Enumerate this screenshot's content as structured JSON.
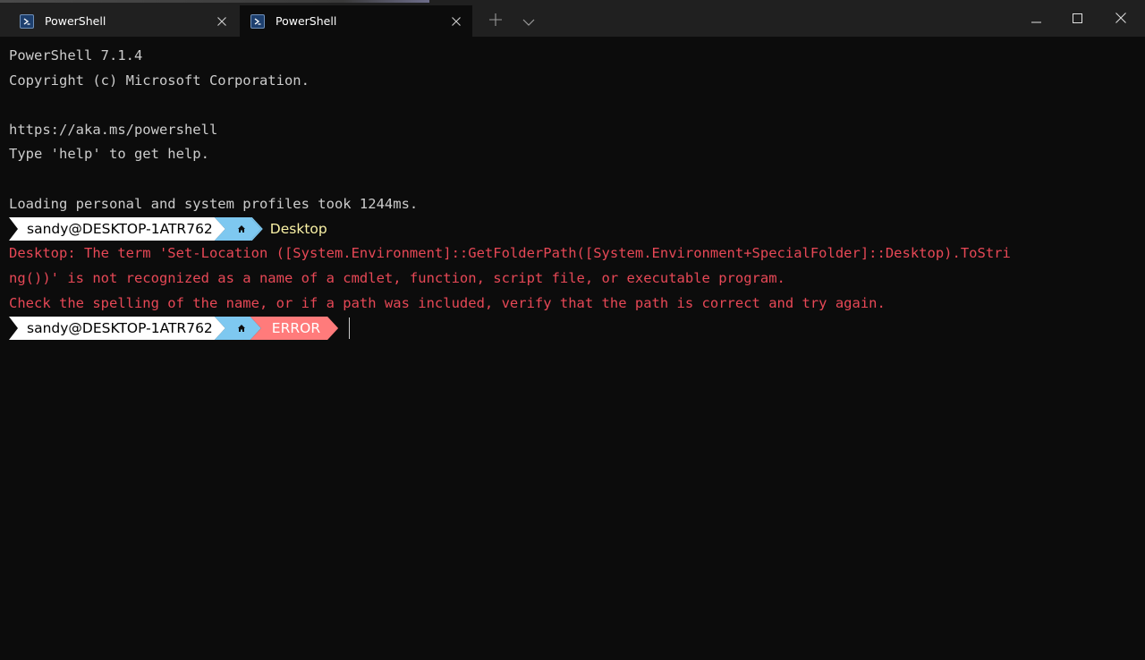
{
  "window": {
    "tabs": [
      {
        "label": "PowerShell",
        "active": false
      },
      {
        "label": "PowerShell",
        "active": true
      }
    ],
    "icons": {
      "tab": "powershell-icon",
      "close": "close-icon",
      "new_tab": "plus-icon",
      "dropdown": "chevron-down-icon",
      "minimize": "minimize-icon",
      "maximize": "maximize-icon",
      "window_close": "close-icon"
    }
  },
  "terminal": {
    "lines": [
      "PowerShell 7.1.4",
      "Copyright (c) Microsoft Corporation.",
      "",
      "https://aka.ms/powershell",
      "Type 'help' to get help.",
      "",
      "Loading personal and system profiles took 1244ms."
    ],
    "prompt1": {
      "user": "sandy@DESKTOP-1ATR762",
      "home_glyph": "home-icon",
      "dir": "Desktop"
    },
    "error_lines": [
      "Desktop: The term 'Set-Location ([System.Environment]::GetFolderPath([System.Environment+SpecialFolder]::Desktop).ToStri",
      "ng())' is not recognized as a name of a cmdlet, function, script file, or executable program.",
      "Check the spelling of the name, or if a path was included, verify that the path is correct and try again."
    ],
    "prompt2": {
      "user": "sandy@DESKTOP-1ATR762",
      "home_glyph": "home-icon",
      "status": "ERROR"
    }
  },
  "colors": {
    "background": "#0c0c0c",
    "titlebar": "#202020",
    "text": "#cccccc",
    "error": "#e74856",
    "prompt_user_bg": "#ffffff",
    "prompt_home_bg": "#7ec8f0",
    "prompt_dir": "#f9f1a5",
    "prompt_error_bg": "#ff7b7b"
  }
}
